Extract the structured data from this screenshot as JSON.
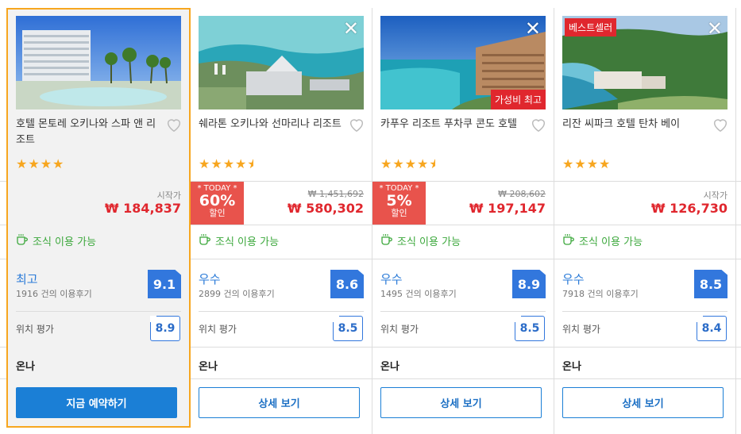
{
  "columns": [
    {
      "name": "호텔 몬토레 오키나와 스파 앤 리조트",
      "stars": "★★★★",
      "price_label": "시작가",
      "price": "₩ 184,837",
      "breakfast": "조식 이용 가능",
      "review_word": "최고",
      "review_count": "1916 건의 이용후기",
      "score": "9.1",
      "location_label": "위치 평가",
      "location_score": "8.9",
      "partner": "온나",
      "button": "지금 예약하기",
      "selected": true
    },
    {
      "name": "쉐라톤 오키나와 선마리나 리조트",
      "stars": "★★★★",
      "today_label": "* TODAY *",
      "discount": "60%",
      "discount_suffix": "할인",
      "original_price": "₩ 1,451,692",
      "price": "₩ 580,302",
      "breakfast": "조식 이용 가능",
      "review_word": "우수",
      "review_count": "2899 건의 이용후기",
      "score": "8.6",
      "location_label": "위치 평가",
      "location_score": "8.5",
      "partner": "온나",
      "button": "상세 보기",
      "close": "✕"
    },
    {
      "name": "카푸우 리조트 푸차쿠 콘도 호텔",
      "stars": "★★★★",
      "tag": "가성비 최고",
      "today_label": "* TODAY *",
      "discount": "5%",
      "discount_suffix": "할인",
      "original_price": "₩ 208,602",
      "price": "₩ 197,147",
      "breakfast": "조식 이용 가능",
      "review_word": "우수",
      "review_count": "1495 건의 이용후기",
      "score": "8.9",
      "location_label": "위치 평가",
      "location_score": "8.5",
      "partner": "온나",
      "button": "상세 보기",
      "close": "✕"
    },
    {
      "name": "리잔 씨파크 호텔 탄차 베이",
      "stars": "★★★★",
      "tag": "베스트셀러",
      "price_label": "시작가",
      "price": "₩ 126,730",
      "breakfast": "조식 이용 가능",
      "review_word": "우수",
      "review_count": "7918 건의 이용후기",
      "score": "8.5",
      "location_label": "위치 평가",
      "location_score": "8.4",
      "partner": "온나",
      "button": "상세 보기",
      "close": "✕"
    }
  ],
  "colors": {
    "accent": "#1b7fd6",
    "price": "#e0272e",
    "selected_border": "#f7a61f",
    "breakfast": "#3ca83c",
    "score_badge": "#3277dd"
  },
  "icons": [
    "heart-icon",
    "close-icon",
    "coffee-cup-icon",
    "star-icon",
    "half-star-icon"
  ]
}
